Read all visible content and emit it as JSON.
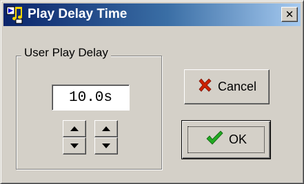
{
  "window": {
    "title": "Play Delay Time",
    "app_icon": "music-note-icon",
    "close_glyph": "✕"
  },
  "group": {
    "label": "User Play Delay",
    "value": "10.0s"
  },
  "buttons": {
    "cancel_label": "Cancel",
    "cancel_icon": "red-x-icon",
    "ok_label": "OK",
    "ok_icon": "green-checkmark-icon"
  },
  "spinners": [
    {
      "up_icon": "arrow-up-icon",
      "down_icon": "arrow-down-icon"
    },
    {
      "up_icon": "arrow-up-icon",
      "down_icon": "arrow-down-icon"
    }
  ],
  "colors": {
    "titlebar_start": "#0a246a",
    "titlebar_end": "#a6caf0",
    "face": "#d4d0c8",
    "cancel_x": "#cc2200",
    "ok_check": "#22aa22"
  }
}
